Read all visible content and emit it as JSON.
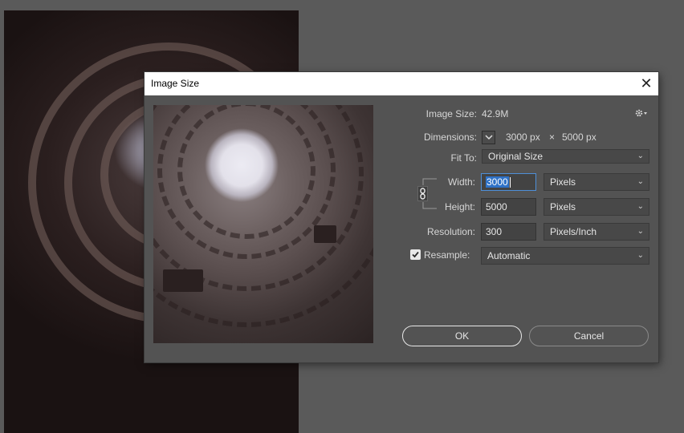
{
  "dialog": {
    "title": "Image Size",
    "close_glyph": "✕"
  },
  "fields": {
    "image_size_label": "Image Size:",
    "image_size_value": "42.9M",
    "dimensions_label": "Dimensions:",
    "dimensions_width": "3000 px",
    "dimensions_times": "×",
    "dimensions_height": "5000 px",
    "fit_to_label": "Fit To:",
    "fit_to_value": "Original Size",
    "width_label": "Width:",
    "width_value": "3000",
    "width_unit": "Pixels",
    "height_label": "Height:",
    "height_value": "5000",
    "height_unit": "Pixels",
    "resolution_label": "Resolution:",
    "resolution_value": "300",
    "resolution_unit": "Pixels/Inch",
    "resample_label": "Resample:",
    "resample_value": "Automatic",
    "resample_checked": true
  },
  "buttons": {
    "ok": "OK",
    "cancel": "Cancel"
  },
  "icons": {
    "gear": "gear-icon",
    "chain": "link-icon",
    "chevron": "chevron-down-icon"
  },
  "colors": {
    "dialog_bg": "#535353",
    "workspace_bg": "#5a5a5a",
    "focus_accent": "#2f72c7"
  }
}
